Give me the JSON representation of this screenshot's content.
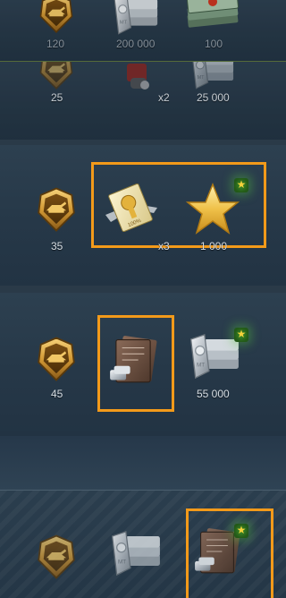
{
  "colors": {
    "highlight_frame": "#f39a1a",
    "row_background": "#2b3e4e",
    "label_text": "#d6dde3",
    "badge_glow": "#3e8f2a"
  },
  "rows": [
    {
      "level": "120",
      "items": [
        {
          "icon": "silver-bars-icon",
          "label": "200 000"
        },
        {
          "icon": "banknotes-stack-icon",
          "label": "100"
        }
      ]
    },
    {
      "level": "25",
      "items": [
        {
          "icon": "consumable-icon",
          "label": "x2"
        },
        {
          "icon": "silver-bars-icon",
          "label": "25 000"
        }
      ]
    },
    {
      "level": "35",
      "items": [
        {
          "icon": "repair-ticket-icon",
          "label": "x3",
          "highlighted": true
        },
        {
          "icon": "gold-star-icon",
          "label": "1 000",
          "highlighted": true,
          "badge": "elite-star-badge-icon"
        }
      ]
    },
    {
      "level": "45",
      "items": [
        {
          "icon": "documents-with-silver-icon",
          "label": "",
          "highlighted": true
        },
        {
          "icon": "silver-bars-icon",
          "label": "55 000",
          "badge": "elite-star-badge-icon"
        }
      ]
    },
    {
      "level": "",
      "items": [
        {
          "icon": "silver-bars-icon",
          "label": ""
        },
        {
          "icon": "documents-with-silver-icon",
          "label": "",
          "highlighted": true,
          "badge": "elite-star-badge-icon"
        }
      ]
    }
  ]
}
